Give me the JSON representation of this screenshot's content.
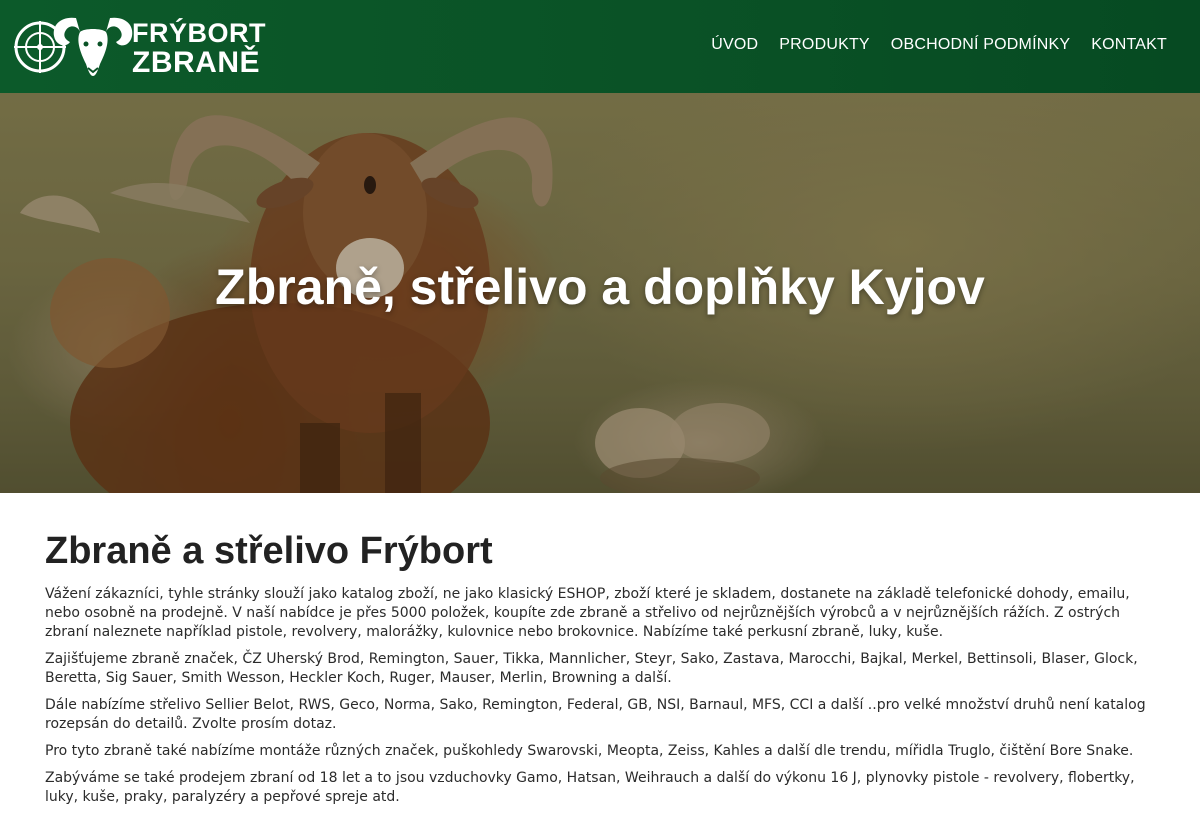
{
  "header": {
    "logo": {
      "line1": "FRÝBORT",
      "line2": "ZBRANĚ"
    },
    "nav": [
      {
        "label": "ÚVOD"
      },
      {
        "label": "PRODUKTY"
      },
      {
        "label": "OBCHODNÍ PODMÍNKY"
      },
      {
        "label": "KONTAKT"
      }
    ]
  },
  "hero": {
    "title": "Zbraně, střelivo a doplňky Kyjov"
  },
  "main": {
    "heading": "Zbraně a střelivo Frýbort",
    "paragraphs": [
      "Vážení zákazníci, tyhle stránky slouží jako katalog zboží, ne jako klasický ESHOP, zboží které je skladem, dostanete na základě telefonické dohody, emailu, nebo osobně na prodejně. V naší nabídce je přes 5000 položek, koupíte zde zbraně a střelivo od nejrůznějších výrobců a v nejrůznějších rážích. Z ostrých zbraní naleznete například pistole, revolvery, malorážky, kulovnice nebo brokovnice. Nabízíme také perkusní zbraně, luky, kuše.",
      "Zajišťujeme zbraně značek, ČZ Uherský Brod, Remington, Sauer, Tikka, Mannlicher, Steyr, Sako, Zastava, Marocchi, Bajkal, Merkel, Bettinsoli, Blaser, Glock, Beretta, Sig Sauer, Smith Wesson, Heckler Koch, Ruger, Mauser, Merlin, Browning a další.",
      "Dále nabízíme střelivo Sellier Belot, RWS, Geco, Norma, Sako, Remington, Federal, GB, NSI, Barnaul, MFS, CCI a další ..pro velké množství druhů není katalog rozepsán do detailů. Zvolte prosím dotaz.",
      "Pro tyto zbraně také nabízíme montáže různých značek, puškohledy Swarovski, Meopta, Zeiss, Kahles a další dle trendu, mířidla Truglo, čištění Bore Snake.",
      "Zabýváme se také prodejem zbraní od 18 let a to jsou vzduchovky Gamo, Hatsan, Weihrauch a další do výkonu 16 J, plynovky pistole - revolvery, flobertky, luky, kuše, praky, paralyzéry a pepřové spreje atd."
    ]
  },
  "icons": {
    "logo": "ram-crosshair-icon"
  },
  "colors": {
    "header_bg": "#0a5226",
    "text": "#222222"
  }
}
